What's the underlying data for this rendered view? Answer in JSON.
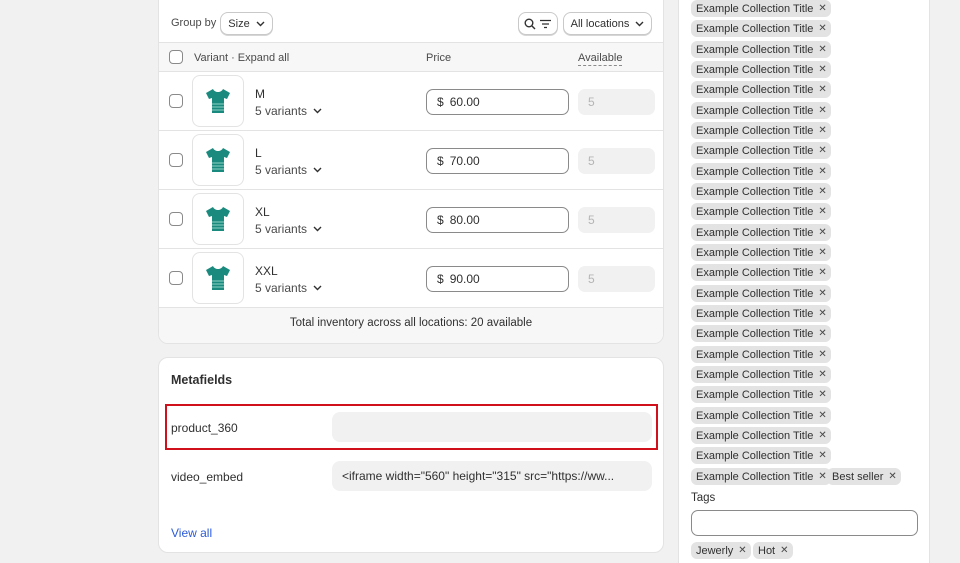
{
  "variants": {
    "group_by_label": "Group by",
    "group_by_value": "Size",
    "locations_label": "All locations",
    "headers": {
      "variant": "Variant · Expand all",
      "price": "Price",
      "available": "Available"
    },
    "rows": [
      {
        "name": "M",
        "variants": "5 variants",
        "currency": "$",
        "price": "60.00",
        "available": "5"
      },
      {
        "name": "L",
        "variants": "5 variants",
        "currency": "$",
        "price": "70.00",
        "available": "5"
      },
      {
        "name": "XL",
        "variants": "5 variants",
        "currency": "$",
        "price": "80.00",
        "available": "5"
      },
      {
        "name": "XXL",
        "variants": "5 variants",
        "currency": "$",
        "price": "90.00",
        "available": "5"
      }
    ],
    "total_inventory": "Total inventory across all locations: 20 available"
  },
  "metafields": {
    "title": "Metafields",
    "fields": [
      {
        "label": "product_360",
        "value": ""
      },
      {
        "label": "video_embed",
        "value": "<iframe width=\"560\" height=\"315\" src=\"https://ww..."
      }
    ],
    "view_all": "View all"
  },
  "collections": {
    "items": [
      "Example Collection Title",
      "Example Collection Title",
      "Example Collection Title",
      "Example Collection Title",
      "Example Collection Title",
      "Example Collection Title",
      "Example Collection Title",
      "Example Collection Title",
      "Example Collection Title",
      "Example Collection Title",
      "Example Collection Title",
      "Example Collection Title",
      "Example Collection Title",
      "Example Collection Title",
      "Example Collection Title",
      "Example Collection Title",
      "Example Collection Title",
      "Example Collection Title",
      "Example Collection Title",
      "Example Collection Title",
      "Example Collection Title",
      "Example Collection Title",
      "Example Collection Title",
      "Example Collection Title"
    ],
    "extra": "Best seller"
  },
  "tags": {
    "label": "Tags",
    "input_value": "",
    "items": [
      "Jewerly",
      "Hot"
    ]
  },
  "colors": {
    "highlight": "#d0101b",
    "link": "#2c5bd6",
    "shirt": "#1a8a7e"
  }
}
